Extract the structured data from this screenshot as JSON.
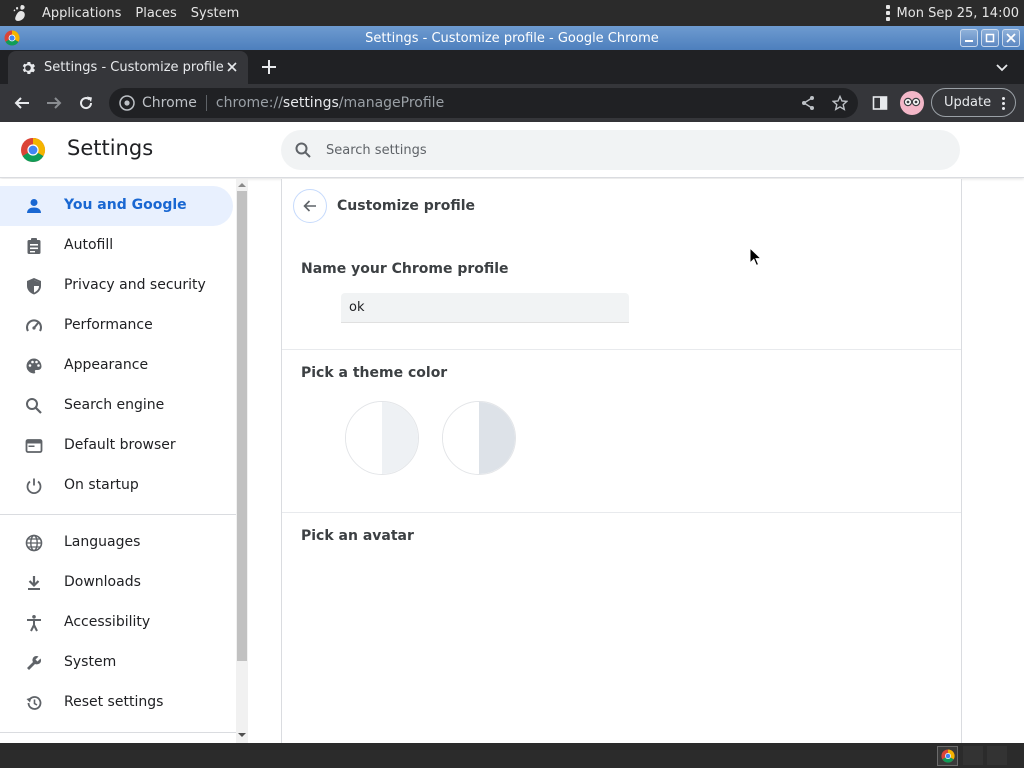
{
  "topbar": {
    "menus": [
      "Applications",
      "Places",
      "System"
    ],
    "clock": "Mon Sep 25, 14:00"
  },
  "window": {
    "title": "Settings - Customize profile - Google Chrome"
  },
  "tab": {
    "title": "Settings - Customize profile"
  },
  "omnibox": {
    "origin_label": "Chrome",
    "url_prefix": "chrome://",
    "url_host": "settings",
    "url_path": "/manageProfile"
  },
  "toolbar": {
    "update_label": "Update"
  },
  "header": {
    "title": "Settings",
    "search_placeholder": "Search settings"
  },
  "sidebar": {
    "items": [
      {
        "label": "You and Google",
        "icon": "person-icon",
        "active": true
      },
      {
        "label": "Autofill",
        "icon": "clipboard-icon"
      },
      {
        "label": "Privacy and security",
        "icon": "shield-icon"
      },
      {
        "label": "Performance",
        "icon": "speedometer-icon"
      },
      {
        "label": "Appearance",
        "icon": "palette-icon"
      },
      {
        "label": "Search engine",
        "icon": "search-icon"
      },
      {
        "label": "Default browser",
        "icon": "browser-window-icon"
      },
      {
        "label": "On startup",
        "icon": "power-icon"
      },
      {
        "label": "Languages",
        "icon": "globe-icon"
      },
      {
        "label": "Downloads",
        "icon": "download-icon"
      },
      {
        "label": "Accessibility",
        "icon": "accessibility-icon"
      },
      {
        "label": "System",
        "icon": "wrench-icon"
      },
      {
        "label": "Reset settings",
        "icon": "history-icon"
      }
    ]
  },
  "main": {
    "page_title": "Customize profile",
    "name_section": {
      "heading": "Name your Chrome profile",
      "value": "ok"
    },
    "theme_section": {
      "heading": "Pick a theme color",
      "swatches": [
        {
          "name": "default-light",
          "right_color": "#eef1f4"
        },
        {
          "name": "default-grey",
          "right_color": "#dde2e8"
        }
      ]
    },
    "avatar_section": {
      "heading": "Pick an avatar"
    }
  },
  "colors": {
    "accent": "#1967d2",
    "active_nav_bg": "#e8f0fe",
    "titlebar": "#5b8ac6"
  }
}
